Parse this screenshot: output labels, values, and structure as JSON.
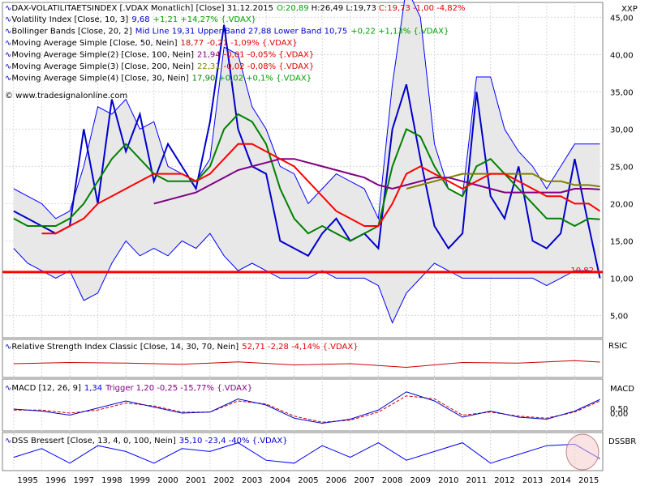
{
  "main": {
    "header": {
      "icon": "indicator-check-icon",
      "title": "DAX-VOLATILITAETSINDEX [.VDAX Monatlich] [Close] 31.12.2015",
      "ohlc": "O:20,89",
      "hl": "H:26,49 L:19,73",
      "close_change": "C:19,73 -1,00 -4,82%"
    },
    "symbol": "XXP",
    "copyright": "© www.tradesignalonline.com",
    "legend": [
      {
        "label": "Volatility Index [Close, 10, 3]",
        "value": "9,68",
        "change": "+1,21 +14,27% {.VDAX}",
        "value_color": "#0000d0",
        "change_color": "#00a000"
      },
      {
        "label": "Bollinger Bands [Close, 20, 2]",
        "value": "Mid Line 19,31 Upper Band 27,88 Lower Band 10,75",
        "change": "+0,22 +1,13% {.VDAX}",
        "value_color": "#0000d0",
        "change_color": "#00a000"
      },
      {
        "label": "Moving Average Simple [Close, 50, Nein]",
        "value": "18,77",
        "change": "-0,21 -1,09% {.VDAX}",
        "value_color": "#e00000",
        "change_color": "#e00000"
      },
      {
        "label": "Moving Average Simple(2) [Close, 100, Nein]",
        "value": "21,94",
        "change": "-0,01 -0,05% {.VDAX}",
        "value_color": "#800080",
        "change_color": "#e00000"
      },
      {
        "label": "Moving Average Simple(3) [Close, 200, Nein]",
        "value": "22,31",
        "change": "-0,02 -0,08% {.VDAX}",
        "value_color": "#808000",
        "change_color": "#e00000"
      },
      {
        "label": "Moving Average Simple(4) [Close, 30, Nein]",
        "value": "17,90",
        "change": "+0,02 +0,1% {.VDAX}",
        "value_color": "#008000",
        "change_color": "#00a000"
      }
    ],
    "y_ticks": [
      "45,00",
      "40,00",
      "35,00",
      "30,00",
      "25,00",
      "20,00",
      "15,00",
      "10,00",
      "5,00"
    ],
    "hline_label": "10,82"
  },
  "rsi": {
    "name": "Relative Strength Index Classic [Close, 14, 30, 70, Nein]",
    "value": "52,71 -2,28 -4,14% {.VDAX}",
    "axis_label": "RSIC"
  },
  "macd": {
    "name": "MACD [12, 26, 9]",
    "value": "1,34",
    "trigger": "Trigger 1,20 -0,25 -15,77% {.VDAX}",
    "axis_label": "MACD",
    "y_ticks": [
      "0,50",
      "0,00"
    ]
  },
  "dss": {
    "name": "DSS Bressert [Close, 13, 4, 0, 100, Nein]",
    "value": "35,10 -23,4 -40% {.VDAX}",
    "axis_label": "DSSBR"
  },
  "x_ticks": [
    "1995",
    "1996",
    "1997",
    "1998",
    "1999",
    "2000",
    "2001",
    "2002",
    "2003",
    "2004",
    "2005",
    "2006",
    "2007",
    "2008",
    "2009",
    "2010",
    "2011",
    "2012",
    "2013",
    "2014",
    "2015"
  ],
  "colors": {
    "vdax": "#0000cc",
    "bollinger": "#0000ff",
    "ma50": "#ff0000",
    "ma100": "#800080",
    "ma200": "#808000",
    "ma30": "#008000",
    "hline": "#ff0000",
    "rsi": "#cc0000",
    "macd": "#0000cc",
    "macd_trigger": "#cc0000",
    "dss": "#0000ff"
  },
  "chart_data": [
    {
      "type": "line",
      "title": "DAX-VOLATILITAETSINDEX [.VDAX Monatlich]",
      "x": [
        1995,
        1995.5,
        1996,
        1996.5,
        1997,
        1997.5,
        1998,
        1998.5,
        1999,
        1999.5,
        2000,
        2000.5,
        2001,
        2001.5,
        2002,
        2002.5,
        2003,
        2003.5,
        2004,
        2004.5,
        2005,
        2005.5,
        2006,
        2006.5,
        2007,
        2007.5,
        2008,
        2008.5,
        2009,
        2009.5,
        2010,
        2010.5,
        2011,
        2011.5,
        2012,
        2012.5,
        2013,
        2013.5,
        2014,
        2014.5,
        2015,
        2015.5,
        2015.9
      ],
      "ylim": [
        2,
        47
      ],
      "horizontal_line": 10.82,
      "series": [
        {
          "name": "Volatility Index [Close, 10, 3]",
          "values": [
            19,
            18,
            17,
            16,
            17,
            30,
            20,
            34,
            27,
            32,
            23,
            28,
            25,
            22,
            31,
            44,
            30,
            25,
            24,
            15,
            14,
            13,
            16,
            18,
            15,
            16,
            14,
            30,
            36,
            26,
            17,
            14,
            16,
            35,
            21,
            18,
            25,
            15,
            14,
            16,
            26,
            17,
            10
          ]
        },
        {
          "name": "Bollinger Bands Upper",
          "values": [
            22,
            21,
            20,
            18,
            19,
            25,
            33,
            32,
            34,
            30,
            31,
            25,
            24,
            23,
            26,
            41,
            40,
            33,
            30,
            25,
            24,
            20,
            22,
            24,
            23,
            22,
            18,
            36,
            49,
            45,
            28,
            22,
            21,
            37,
            37,
            30,
            27,
            25,
            22,
            25,
            28,
            28,
            28
          ]
        },
        {
          "name": "Bollinger Bands Lower",
          "values": [
            14,
            12,
            11,
            10,
            11,
            7,
            8,
            12,
            15,
            13,
            14,
            13,
            15,
            14,
            16,
            13,
            11,
            12,
            11,
            10,
            10,
            10,
            11,
            10,
            10,
            10,
            9,
            4,
            8,
            10,
            12,
            11,
            10,
            10,
            10,
            10,
            10,
            10,
            9,
            10,
            11,
            11,
            10.75
          ]
        },
        {
          "name": "Moving Average Simple [Close, 50, Nein]",
          "values": [
            null,
            null,
            16,
            16,
            17,
            18,
            20,
            21,
            22,
            23,
            24,
            24,
            24,
            23,
            24,
            26,
            28,
            28,
            27,
            26,
            25,
            23,
            21,
            19,
            18,
            17,
            17,
            20,
            24,
            25,
            24,
            23,
            22,
            23,
            24,
            24,
            23,
            22,
            21,
            21,
            20,
            20,
            19
          ]
        },
        {
          "name": "Moving Average Simple(2) [Close, 100, Nein]",
          "values": [
            null,
            null,
            null,
            null,
            null,
            null,
            null,
            null,
            null,
            null,
            20,
            20.5,
            21,
            21.5,
            22.5,
            23.5,
            24.5,
            25,
            25.5,
            26,
            26,
            25.5,
            25,
            24.5,
            24,
            23.5,
            22.5,
            22,
            22.5,
            23,
            23.5,
            23.5,
            23,
            22.5,
            22,
            21.5,
            21.5,
            21.5,
            21.5,
            21.5,
            22,
            22,
            21.9
          ]
        },
        {
          "name": "Moving Average Simple(3) [Close, 200, Nein]",
          "values": [
            null,
            null,
            null,
            null,
            null,
            null,
            null,
            null,
            null,
            null,
            null,
            null,
            null,
            null,
            null,
            null,
            null,
            null,
            null,
            null,
            null,
            null,
            null,
            null,
            null,
            null,
            null,
            null,
            22,
            22.5,
            23,
            23.5,
            24,
            24,
            24,
            24,
            24,
            24,
            23,
            23,
            22.5,
            22.5,
            22.3
          ]
        },
        {
          "name": "Moving Average Simple(4) [Close, 30, Nein]",
          "values": [
            18,
            17,
            17,
            17,
            18,
            20,
            23,
            26,
            28,
            26,
            24,
            23,
            23,
            23,
            25,
            30,
            32,
            31,
            28,
            22,
            18,
            16,
            17,
            16,
            15,
            16,
            17,
            25,
            30,
            29,
            25,
            22,
            21,
            25,
            26,
            24,
            22,
            20,
            18,
            18,
            17,
            18,
            17.9
          ]
        }
      ]
    },
    {
      "type": "line",
      "title": "Relative Strength Index Classic [Close, 14, 30, 70, Nein]",
      "x": [
        1995,
        1997,
        1999,
        2001,
        2003,
        2005,
        2007,
        2009,
        2011,
        2013,
        2015,
        2015.9
      ],
      "ylim": [
        30,
        70
      ],
      "series": [
        {
          "name": "RSI",
          "values": [
            50,
            52,
            51,
            49,
            53,
            48,
            50,
            44,
            52,
            51,
            55,
            52.71
          ]
        }
      ]
    },
    {
      "type": "line",
      "title": "MACD [12, 26, 9]",
      "x": [
        1995,
        1996,
        1997,
        1998,
        1999,
        2000,
        2001,
        2002,
        2003,
        2004,
        2005,
        2006,
        2007,
        2008,
        2009,
        2010,
        2011,
        2012,
        2013,
        2014,
        2015,
        2015.9
      ],
      "ylim": [
        -1.6,
        2.4
      ],
      "series": [
        {
          "name": "MACD",
          "values": [
            0.4,
            0.2,
            -0.2,
            0.5,
            1.2,
            0.6,
            0,
            0.1,
            1.4,
            0.8,
            -0.5,
            -1.0,
            -0.6,
            0.3,
            2.1,
            1.2,
            -0.4,
            0.2,
            -0.4,
            -0.6,
            0.2,
            1.34
          ]
        },
        {
          "name": "Trigger",
          "values": [
            0.3,
            0.3,
            0,
            0.3,
            1.0,
            0.7,
            0.1,
            0.1,
            1.2,
            0.9,
            -0.3,
            -0.9,
            -0.7,
            0.1,
            1.7,
            1.4,
            -0.2,
            0.1,
            -0.3,
            -0.5,
            0.1,
            1.2
          ]
        }
      ]
    },
    {
      "type": "line",
      "title": "DSS Bressert [Close, 13, 4, 0, 100, Nein]",
      "x": [
        1995,
        1996,
        1997,
        1998,
        1999,
        2000,
        2001,
        2002,
        2003,
        2004,
        2005,
        2006,
        2007,
        2008,
        2009,
        2010,
        2011,
        2012,
        2013,
        2014,
        2015,
        2015.9
      ],
      "ylim": [
        0,
        100
      ],
      "series": [
        {
          "name": "DSS",
          "values": [
            40,
            70,
            20,
            80,
            60,
            20,
            70,
            60,
            90,
            30,
            20,
            80,
            40,
            90,
            30,
            60,
            90,
            20,
            50,
            80,
            85,
            35.1
          ]
        }
      ]
    }
  ]
}
